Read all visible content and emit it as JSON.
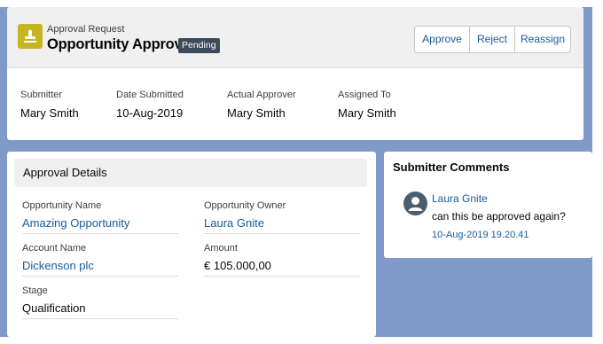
{
  "header": {
    "object_label": "Approval Request",
    "title": "Opportunity Approval",
    "status_badge": "Pending",
    "buttons": {
      "approve": "Approve",
      "reject": "Reject",
      "reassign": "Reassign"
    },
    "fields": [
      {
        "label": "Submitter",
        "value": "Mary Smith"
      },
      {
        "label": "Date Submitted",
        "value": "10-Aug-2019"
      },
      {
        "label": "Actual Approver",
        "value": "Mary Smith"
      },
      {
        "label": "Assigned To",
        "value": "Mary Smith"
      }
    ]
  },
  "details": {
    "section_title": "Approval Details",
    "opportunity_name": {
      "label": "Opportunity Name",
      "value": "Amazing Opportunity"
    },
    "opportunity_owner": {
      "label": "Opportunity Owner",
      "value": "Laura Gnite"
    },
    "account_name": {
      "label": "Account Name",
      "value": "Dickenson plc"
    },
    "amount": {
      "label": "Amount",
      "value": "€ 105.000,00"
    },
    "stage": {
      "label": "Stage",
      "value": "Qualification"
    }
  },
  "comments": {
    "title": "Submitter Comments",
    "items": [
      {
        "author": "Laura Gnite",
        "text": "can this be approved again?",
        "timestamp": "10-Aug-2019 19.20.41",
        "avatar_icon": "user-icon"
      }
    ]
  },
  "icons": {
    "app": "stamp-icon"
  },
  "colors": {
    "accent_link": "#1a5b9a",
    "app_icon_bg": "#c5b520",
    "badge_bg": "#3e4a5c",
    "page_bg": "#7f9ac9"
  }
}
